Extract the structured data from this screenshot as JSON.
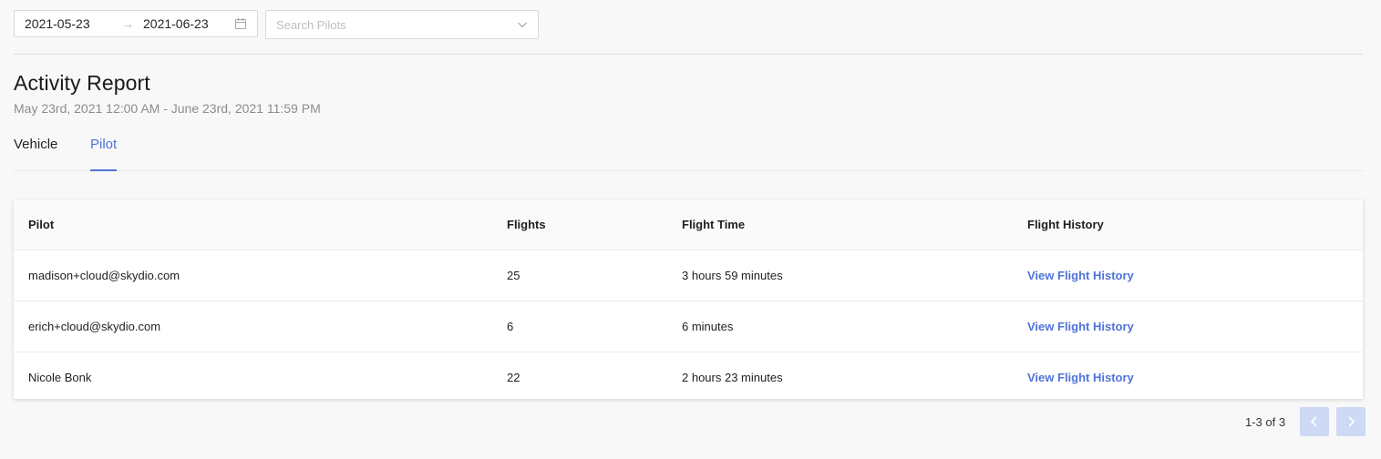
{
  "filters": {
    "date_start": "2021-05-23",
    "date_separator": "→",
    "date_end": "2021-06-23",
    "pilot_search_placeholder": "Search Pilots"
  },
  "report": {
    "title": "Activity Report",
    "subtitle": "May 23rd, 2021 12:00 AM - June 23rd, 2021 11:59 PM"
  },
  "tabs": [
    {
      "label": "Vehicle",
      "active": false
    },
    {
      "label": "Pilot",
      "active": true
    }
  ],
  "table": {
    "headers": {
      "pilot": "Pilot",
      "flights": "Flights",
      "flight_time": "Flight Time",
      "flight_history": "Flight History"
    },
    "rows": [
      {
        "pilot": "madison+cloud@skydio.com",
        "flights": "25",
        "flight_time": "3 hours 59 minutes",
        "history_link": "View Flight History"
      },
      {
        "pilot": "erich+cloud@skydio.com",
        "flights": "6",
        "flight_time": "6 minutes",
        "history_link": "View Flight History"
      },
      {
        "pilot": "Nicole Bonk",
        "flights": "22",
        "flight_time": "2 hours 23 minutes",
        "history_link": "View Flight History"
      }
    ]
  },
  "pagination": {
    "range_label": "1-3 of 3"
  },
  "icons": {
    "calendar": "calendar-icon",
    "dropdown": "chevron-down-icon",
    "prev": "chevron-left-icon",
    "next": "chevron-right-icon"
  },
  "colors": {
    "accent": "#4f73d9",
    "background": "#f8f8f8",
    "pagination_button": "#cdd9f5"
  }
}
